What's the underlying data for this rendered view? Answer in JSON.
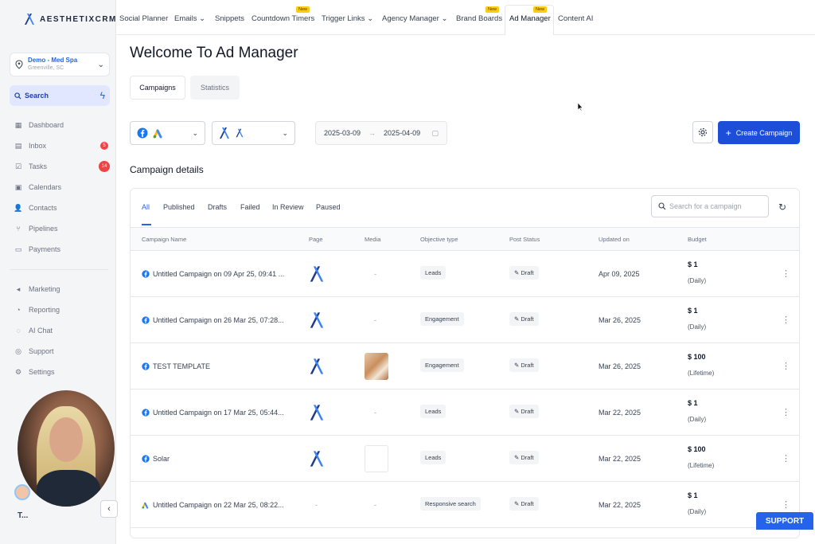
{
  "brand": {
    "logo_text": "AESTHETIXCRM",
    "accent": "#2563eb",
    "primary_button": "#1d4ed8"
  },
  "sidebar": {
    "location": {
      "name": "Demo - Med Spa",
      "city": "Greenville, SC"
    },
    "search_label": "Search",
    "items": [
      {
        "label": "Dashboard",
        "icon": "dashboard-icon"
      },
      {
        "label": "Inbox",
        "icon": "inbox-icon",
        "badge": "5"
      },
      {
        "label": "Tasks",
        "icon": "tasks-icon",
        "badge": "14"
      },
      {
        "label": "Calendars",
        "icon": "calendar-icon"
      },
      {
        "label": "Contacts",
        "icon": "contacts-icon"
      },
      {
        "label": "Pipelines",
        "icon": "pipelines-icon"
      },
      {
        "label": "Payments",
        "icon": "payments-icon"
      }
    ],
    "items2": [
      {
        "label": "Marketing",
        "icon": "marketing-icon"
      },
      {
        "label": "Reporting",
        "icon": "reporting-icon"
      },
      {
        "label": "AI Chat",
        "icon": "ai-chat-icon"
      },
      {
        "label": "Support",
        "icon": "support-icon"
      },
      {
        "label": "Settings",
        "icon": "settings-icon"
      }
    ],
    "footer_mark": "T..."
  },
  "topnav": {
    "items": [
      {
        "label": "Social Planner"
      },
      {
        "label": "Emails",
        "dropdown": true
      },
      {
        "label": "Snippets"
      },
      {
        "label": "Countdown Timers",
        "badge": "New"
      },
      {
        "label": "Trigger Links",
        "dropdown": true
      },
      {
        "label": "Agency Manager",
        "dropdown": true
      },
      {
        "label": "Brand Boards",
        "badge": "New"
      },
      {
        "label": "Ad Manager",
        "badge": "New",
        "active": true
      },
      {
        "label": "Content AI"
      }
    ]
  },
  "main": {
    "title": "Welcome To Ad Manager",
    "tabs": [
      "Campaigns",
      "Statistics"
    ],
    "date_from": "2025-03-09",
    "date_to": "2025-04-09",
    "create_label": "Create Campaign",
    "section_title": "Campaign details",
    "filter_tabs": [
      "All",
      "Published",
      "Drafts",
      "Failed",
      "In Review",
      "Paused"
    ],
    "search_placeholder": "Search for a campaign",
    "columns": [
      "Campaign Name",
      "Page",
      "Media",
      "Objective type",
      "Post Status",
      "Updated on",
      "Budget"
    ],
    "rows": [
      {
        "platform": "facebook",
        "name": "Untitled Campaign on 09 Apr 25, 09:41 ...",
        "page": "logo",
        "media": "-",
        "objective": "Leads",
        "status": "Draft",
        "updated": "Apr 09, 2025",
        "budget": "$ 1",
        "period": "(Daily)"
      },
      {
        "platform": "facebook",
        "name": "Untitled Campaign on 26 Mar 25, 07:28...",
        "page": "logo",
        "media": "-",
        "objective": "Engagement",
        "status": "Draft",
        "updated": "Mar 26, 2025",
        "budget": "$ 1",
        "period": "(Daily)"
      },
      {
        "platform": "facebook",
        "name": "TEST TEMPLATE",
        "page": "logo",
        "media": "image",
        "objective": "Engagement",
        "status": "Draft",
        "updated": "Mar 26, 2025",
        "budget": "$ 100",
        "period": "(Lifetime)"
      },
      {
        "platform": "facebook",
        "name": "Untitled Campaign on 17 Mar 25, 05:44...",
        "page": "logo",
        "media": "-",
        "objective": "Leads",
        "status": "Draft",
        "updated": "Mar 22, 2025",
        "budget": "$ 1",
        "period": "(Daily)"
      },
      {
        "platform": "facebook",
        "name": "Solar",
        "page": "logo",
        "media": "blank",
        "objective": "Leads",
        "status": "Draft",
        "updated": "Mar 22, 2025",
        "budget": "$ 100",
        "period": "(Lifetime)"
      },
      {
        "platform": "google",
        "name": "Untitled Campaign on 22 Mar 25, 08:22...",
        "page": "-",
        "media": "-",
        "objective": "Responsive search",
        "status": "Draft",
        "updated": "Mar 22, 2025",
        "budget": "$ 1",
        "period": "(Daily)"
      }
    ]
  },
  "support_label": "SUPPORT"
}
